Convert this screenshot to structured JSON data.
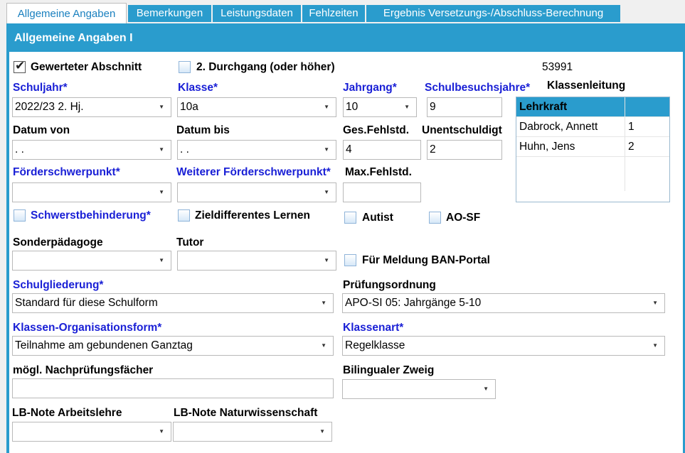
{
  "tabs": [
    {
      "label": "Allgemeine Angaben",
      "active": true
    },
    {
      "label": "Bemerkungen",
      "active": false
    },
    {
      "label": "Leistungsdaten",
      "active": false
    },
    {
      "label": "Fehlzeiten",
      "active": false
    },
    {
      "label": "Ergebnis Versetzungs-/Abschluss-Berechnung",
      "active": false
    }
  ],
  "panel": {
    "title": "Allgemeine Angaben I"
  },
  "checkboxes": {
    "gewerteter_abschnitt": {
      "label": "Gewerteter Abschnitt",
      "checked": true
    },
    "durchgang": {
      "label": "2. Durchgang (oder höher)",
      "checked": false
    },
    "schwerstbehinderung": {
      "label": "Schwerstbehinderung*",
      "checked": false
    },
    "zieldifferentes": {
      "label": "Zieldifferentes Lernen",
      "checked": false
    },
    "autist": {
      "label": "Autist",
      "checked": false
    },
    "aosf": {
      "label": "AO-SF",
      "checked": false
    },
    "ban_portal": {
      "label": "Für Meldung BAN-Portal",
      "checked": false
    }
  },
  "id_number": "53991",
  "fields": {
    "schuljahr": {
      "label": "Schuljahr*",
      "value": "2022/23 2. Hj."
    },
    "klasse": {
      "label": "Klasse*",
      "value": "10a"
    },
    "jahrgang": {
      "label": "Jahrgang*",
      "value": "10"
    },
    "schulbesuchsjahre": {
      "label": "Schulbesuchsjahre*",
      "value": "9"
    },
    "datum_von": {
      "label": "Datum von",
      "value": " .  ."
    },
    "datum_bis": {
      "label": "Datum bis",
      "value": " .  ."
    },
    "ges_fehlstd": {
      "label": "Ges.Fehlstd.",
      "value": "4"
    },
    "unentschuldigt": {
      "label": "Unentschuldigt",
      "value": "2"
    },
    "foerderschwerpunkt": {
      "label": "Förderschwerpunkt*",
      "value": ""
    },
    "weiterer_foerderschwerpunkt": {
      "label": "Weiterer Förderschwerpunkt*",
      "value": ""
    },
    "max_fehlstd": {
      "label": "Max.Fehlstd.",
      "value": ""
    },
    "sonderpaedagoge": {
      "label": "Sonderpädagoge",
      "value": ""
    },
    "tutor": {
      "label": "Tutor",
      "value": ""
    },
    "schulgliederung": {
      "label": "Schulgliederung*",
      "value": "Standard für diese Schulform"
    },
    "pruefungsordnung": {
      "label": "Prüfungsordnung",
      "value": "APO-SI 05: Jahrgänge 5-10"
    },
    "klassen_orgform": {
      "label": "Klassen-Organisationsform*",
      "value": "Teilnahme am gebundenen Ganztag"
    },
    "klassenart": {
      "label": "Klassenart*",
      "value": "Regelklasse"
    },
    "nachpruefungsfaecher": {
      "label": "mögl. Nachprüfungsfächer",
      "value": ""
    },
    "bilingualer_zweig": {
      "label": "Bilingualer Zweig",
      "value": ""
    },
    "lb_arbeitslehre": {
      "label": "LB-Note Arbeitslehre",
      "value": ""
    },
    "lb_naturwissenschaft": {
      "label": "LB-Note Naturwissenschaft",
      "value": ""
    }
  },
  "klassenleitung": {
    "title": "Klassenleitung",
    "header": "Lehrkraft",
    "rows": [
      {
        "name": "Dabrock, Annett",
        "nr": "1"
      },
      {
        "name": "Huhn, Jens",
        "nr": "2"
      }
    ]
  },
  "colors": {
    "accent": "#2a9ccd",
    "required": "#1a20d6"
  }
}
